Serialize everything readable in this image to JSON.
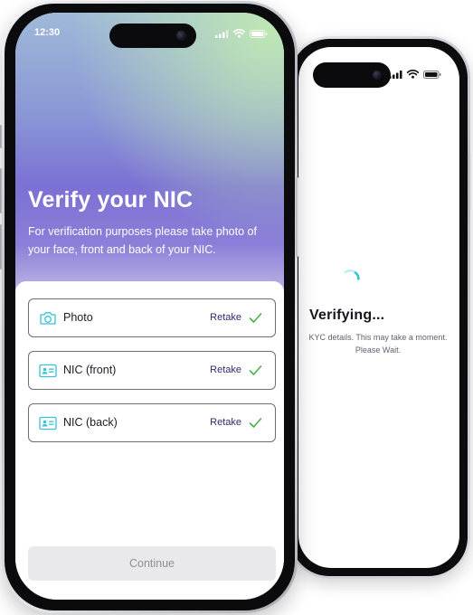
{
  "front_phone": {
    "status_bar": {
      "time": "12:30",
      "icons": [
        "signal-icon",
        "wifi-icon",
        "battery-icon"
      ]
    },
    "title": "Verify your NIC",
    "description": "For verification purposes please take photo of your face, front and back of your NIC.",
    "documents": [
      {
        "label": "Photo",
        "icon": "camera-icon",
        "action": "Retake",
        "status": "check-icon"
      },
      {
        "label": "NIC (front)",
        "icon": "id-card-icon",
        "action": "Retake",
        "status": "check-icon"
      },
      {
        "label": "NIC (back)",
        "icon": "id-card-icon",
        "action": "Retake",
        "status": "check-icon"
      }
    ],
    "continue_label": "Continue"
  },
  "back_phone": {
    "status_bar": {
      "icons": [
        "signal-icon",
        "wifi-icon",
        "battery-icon"
      ]
    },
    "title": "Verifying...",
    "subtitle_line1": "KYC details. This may take a moment.",
    "subtitle_line2": "Please Wait."
  },
  "colors": {
    "accent_teal": "#35c2d6",
    "check_green": "#4caf50",
    "retake_text": "#2e2a6e",
    "gradient_top": "#9fb9d8",
    "gradient_mid": "#7b71d4",
    "gradient_corner": "#bfe7b4"
  }
}
